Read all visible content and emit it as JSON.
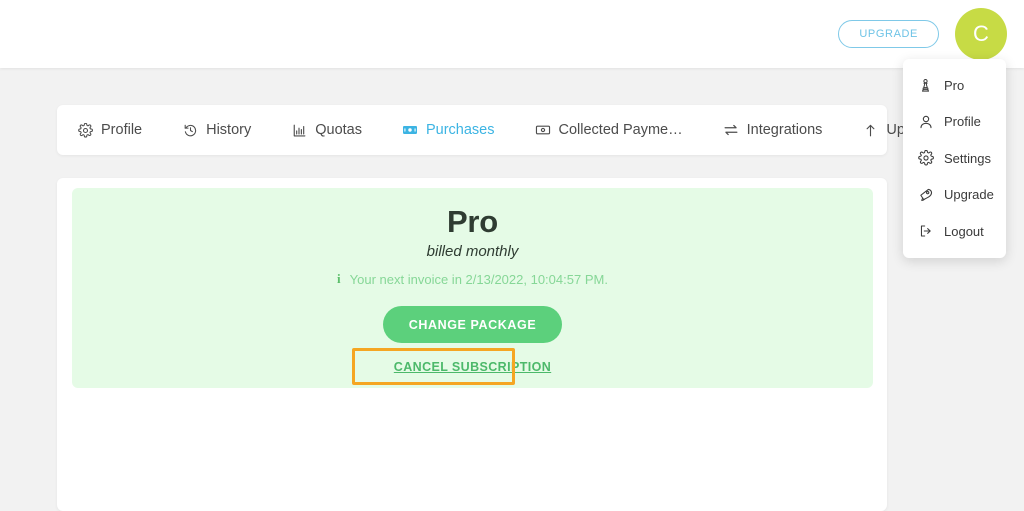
{
  "header": {
    "upgrade_button_label": "UPGRADE",
    "avatar_initial": "C",
    "accent_blue": "#6ec3e6",
    "avatar_color": "#c7db45"
  },
  "dropdown": {
    "items": [
      {
        "label": "Pro",
        "icon": "chess-pawn-icon"
      },
      {
        "label": "Profile",
        "icon": "user-icon"
      },
      {
        "label": "Settings",
        "icon": "gear-icon"
      },
      {
        "label": "Upgrade",
        "icon": "rocket-icon"
      },
      {
        "label": "Logout",
        "icon": "sign-out-icon"
      }
    ]
  },
  "tabs": [
    {
      "label": "Profile",
      "icon": "gear-icon",
      "active": false
    },
    {
      "label": "History",
      "icon": "history-icon",
      "active": false
    },
    {
      "label": "Quotas",
      "icon": "bar-chart-icon",
      "active": false
    },
    {
      "label": "Purchases",
      "icon": "banknote-icon",
      "active": true
    },
    {
      "label": "Collected Payme…",
      "icon": "money-bill-icon",
      "active": false
    },
    {
      "label": "Integrations",
      "icon": "exchange-icon",
      "active": false
    },
    {
      "label": "Upgrade",
      "icon": "arrow-up-icon",
      "active": false
    }
  ],
  "plan": {
    "name": "Pro",
    "billing_cycle": "billed monthly",
    "info_icon": "info-icon",
    "next_invoice_text": "Your next invoice in 2/13/2022, 10:04:57 PM.",
    "change_package_label": "CHANGE PACKAGE",
    "cancel_subscription_label": "CANCEL SUBSCRIPTION",
    "panel_color": "#e5fbe6",
    "button_color": "#5cd07c",
    "highlight_color": "#f5a623"
  }
}
